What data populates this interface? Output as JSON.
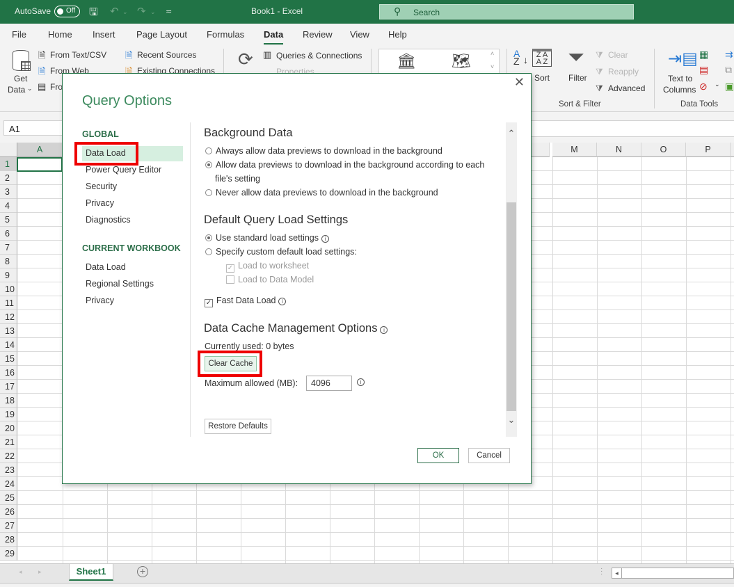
{
  "titlebar": {
    "autosave_label": "AutoSave",
    "autosave_state": "Off",
    "document_title": "Book1  -  Excel",
    "search_placeholder": "Search",
    "icons": [
      "save-icon",
      "undo-icon",
      "redo-icon",
      "customize-quick-access-icon"
    ]
  },
  "menu": {
    "tabs": [
      "File",
      "Home",
      "Insert",
      "Page Layout",
      "Formulas",
      "Data",
      "Review",
      "View",
      "Help"
    ],
    "active": "Data"
  },
  "ribbon": {
    "get_data": {
      "line1": "Get",
      "line2": "Data"
    },
    "from_text_csv": "From Text/CSV",
    "from_web": "From Web",
    "from_table": "Fro",
    "recent_sources": "Recent Sources",
    "existing_connections": "Existing Connections",
    "queries_connections": "Queries & Connections",
    "properties": "Properties",
    "sort": "Sort",
    "filter": "Filter",
    "clear": "Clear",
    "reapply": "Reapply",
    "advanced": "Advanced",
    "sort_filter_group": "Sort & Filter",
    "text_to_columns": {
      "line1": "Text to",
      "line2": "Columns"
    },
    "data_tools_group": "Data Tools"
  },
  "namebox": "A1",
  "grid": {
    "columns_left": [
      "A"
    ],
    "columns_right": [
      "M",
      "N",
      "O",
      "P"
    ],
    "rows": [
      "1",
      "2",
      "3",
      "4",
      "5",
      "6",
      "7",
      "8",
      "9",
      "10",
      "11",
      "12",
      "13",
      "14",
      "15",
      "16",
      "17",
      "18",
      "19",
      "20",
      "21",
      "22",
      "23",
      "24",
      "25",
      "26",
      "27",
      "28",
      "29"
    ],
    "selected_cell": "A1"
  },
  "sheets": {
    "tabs": [
      "Sheet1"
    ],
    "active": "Sheet1"
  },
  "dialog": {
    "title": "Query Options",
    "close_label": "✕",
    "nav": {
      "global_header": "GLOBAL",
      "global_items": [
        "Data Load",
        "Power Query Editor",
        "Security",
        "Privacy",
        "Diagnostics"
      ],
      "workbook_header": "CURRENT WORKBOOK",
      "workbook_items": [
        "Data Load",
        "Regional Settings",
        "Privacy"
      ],
      "selected": "Data Load"
    },
    "background_data": {
      "heading": "Background Data",
      "options": [
        {
          "label": "Always allow data previews to download in the background",
          "selected": false
        },
        {
          "label": "Allow data previews to download in the background according to each",
          "label2": "file's setting",
          "selected": true
        },
        {
          "label": "Never allow data previews to download in the background",
          "selected": false
        }
      ]
    },
    "default_load": {
      "heading": "Default Query Load Settings",
      "standard": "Use standard load settings",
      "custom": "Specify custom default load settings:",
      "load_worksheet": "Load to worksheet",
      "load_worksheet_checked": true,
      "load_model": "Load to Data Model",
      "load_model_checked": false,
      "fast_load": "Fast Data Load",
      "fast_load_checked": true
    },
    "cache": {
      "heading": "Data Cache Management Options",
      "currently_used": "Currently used: 0 bytes",
      "clear_button": "Clear Cache",
      "max_label": "Maximum allowed (MB):",
      "max_value": "4096"
    },
    "restore_defaults": "Restore Defaults",
    "ok": "OK",
    "cancel": "Cancel"
  },
  "colors": {
    "excel_green": "#217346",
    "highlight_red": "#e00000",
    "nav_selected_bg": "#d6efe0"
  }
}
